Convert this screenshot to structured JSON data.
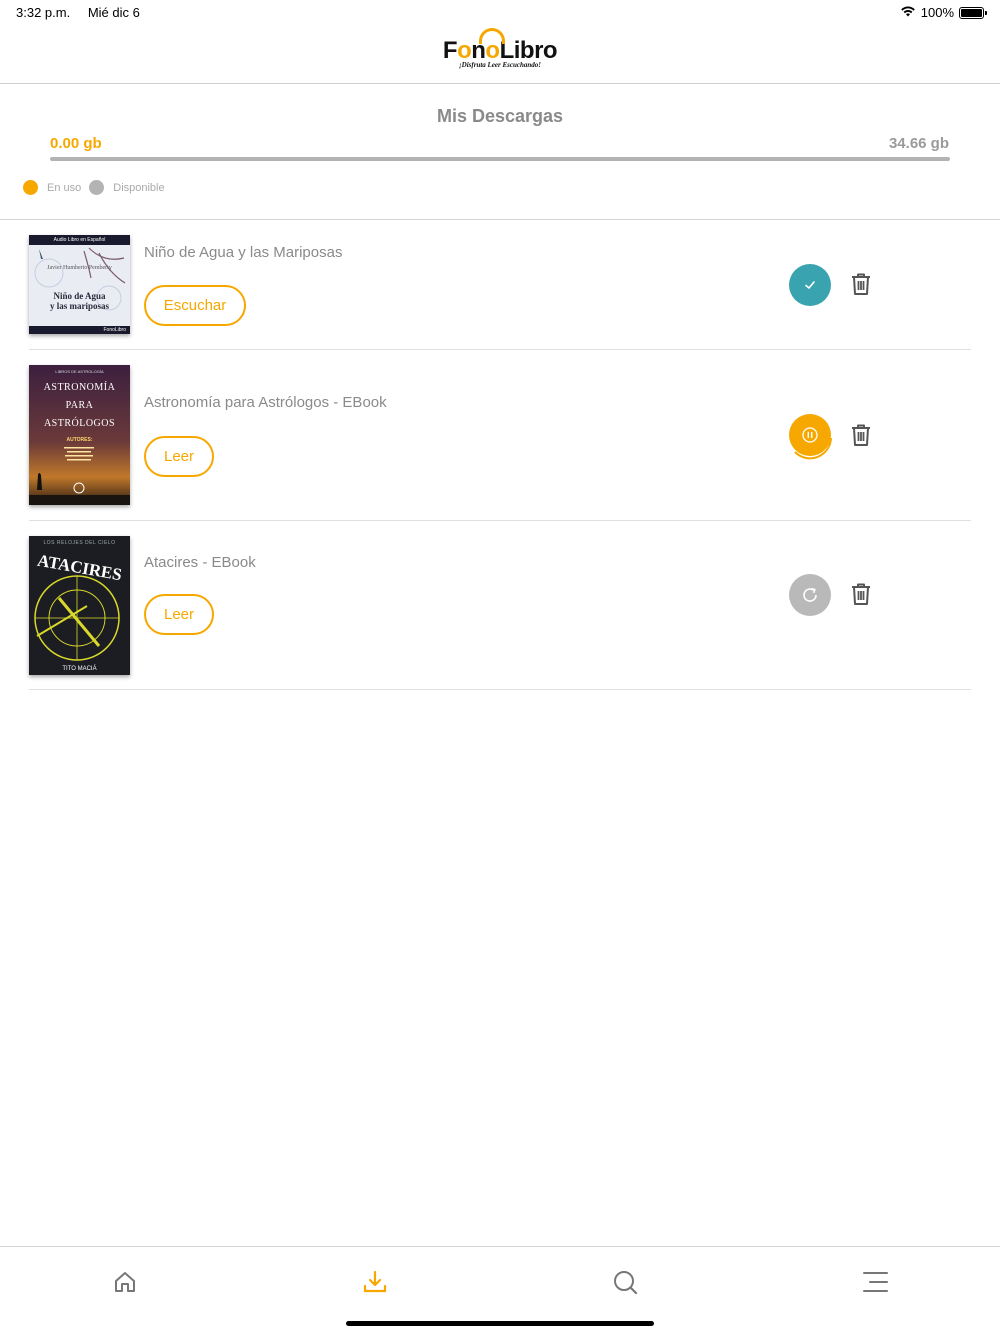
{
  "status_bar": {
    "time": "3:32 p.m.",
    "date": "Mié dic 6",
    "battery": "100%"
  },
  "header": {
    "logo_text_1": "F",
    "logo_text_2": "n",
    "logo_text_3": "Libro",
    "logo_tagline": "¡Disfruta Leer Escuchando!"
  },
  "storage": {
    "title": "Mis Descargas",
    "used": "0.00 gb",
    "total": "34.66 gb",
    "used_fraction": 0.0,
    "legend": [
      {
        "label": "En uso",
        "color": "#f7a800"
      },
      {
        "label": "Disponible",
        "color": "#b3b3b3"
      }
    ]
  },
  "books": [
    {
      "title": "Niño de Agua y las Mariposas",
      "action_label": "Escuchar",
      "download_status": "completed",
      "cover": {
        "top_text": "Audio Libro en Español",
        "author": "Javier Humberto Pemberty",
        "book_title_1": "Niño de Agua",
        "book_title_2": "y las mariposas",
        "brand": "FonoLibro"
      }
    },
    {
      "title": "Astronomía para Astrólogos - EBook",
      "action_label": "Leer",
      "download_status": "paused",
      "cover": {
        "top_text": "LIBROS DE ASTROLOGÍA",
        "line1": "ASTRONOMÍA",
        "line2": "PARA",
        "line3": "ASTRÓLOGOS",
        "authors_label": "AUTORES:"
      }
    },
    {
      "title": "Atacires - EBook",
      "action_label": "Leer",
      "download_status": "pending",
      "cover": {
        "top_text": "LOS RELOJES DEL CIELO",
        "main": "ATACIRES",
        "author": "TITO MACIÁ"
      }
    }
  ],
  "tab_bar": {
    "tabs": [
      {
        "name": "home",
        "icon": "home-icon",
        "active": false
      },
      {
        "name": "downloads",
        "icon": "download-icon",
        "active": true
      },
      {
        "name": "search",
        "icon": "search-icon",
        "active": false
      },
      {
        "name": "menu",
        "icon": "menu-icon",
        "active": false
      }
    ]
  },
  "colors": {
    "accent": "#f7a800",
    "completed": "#3aa3b0",
    "pending": "#b9b9b9",
    "text_gray": "#8a8a8a"
  }
}
